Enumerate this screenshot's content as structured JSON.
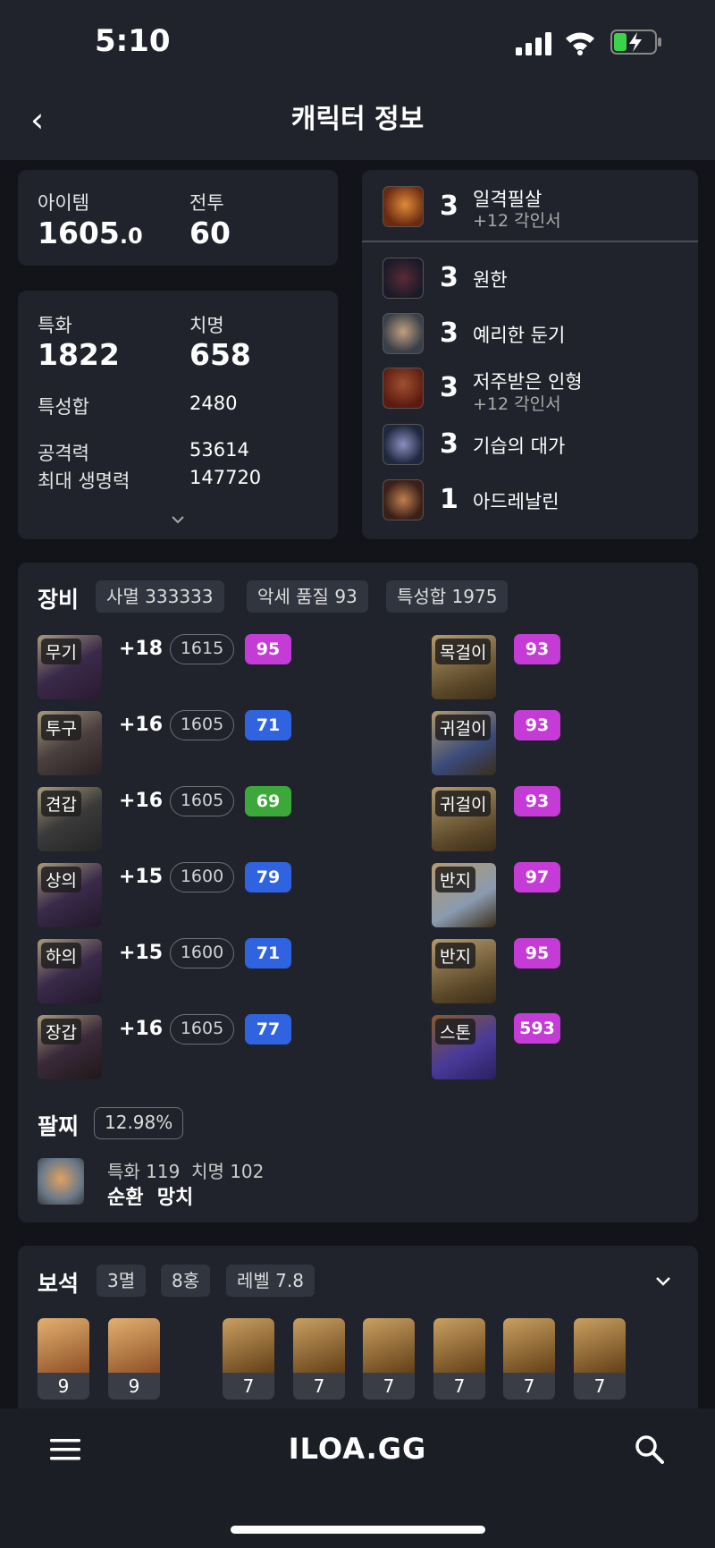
{
  "status": {
    "time": "5:10"
  },
  "header": {
    "title": "캐릭터 정보",
    "back": "‹"
  },
  "stats": {
    "item_label": "아이템",
    "item_value": "1605",
    "item_decimal": ".0",
    "battle_label": "전투",
    "battle_value": "60",
    "spec_label": "특화",
    "spec_value": "1822",
    "crit_label": "치명",
    "crit_value": "658",
    "sum_label": "특성합",
    "sum_value": "2480",
    "atk_label": "공격력",
    "atk_value": "53614",
    "hp_label": "최대 생명력",
    "hp_value": "147720"
  },
  "engravings": [
    {
      "level": "3",
      "name": "일격필살",
      "sub": "+12 각인서"
    },
    {
      "level": "3",
      "name": "원한",
      "sub": ""
    },
    {
      "level": "3",
      "name": "예리한 둔기",
      "sub": ""
    },
    {
      "level": "3",
      "name": "저주받은 인형",
      "sub": "+12 각인서"
    },
    {
      "level": "3",
      "name": "기습의 대가",
      "sub": ""
    },
    {
      "level": "1",
      "name": "아드레날린",
      "sub": ""
    }
  ],
  "equipment": {
    "title": "장비",
    "badges": [
      "사멸 333333",
      "악세 품질 93",
      "특성합 1975"
    ],
    "gear": [
      {
        "tag": "무기",
        "enh": "+18",
        "ilvl": "1615",
        "qual": "95",
        "color": "#c43bd6"
      },
      {
        "tag": "투구",
        "enh": "+16",
        "ilvl": "1605",
        "qual": "71",
        "color": "#2f63e0"
      },
      {
        "tag": "견갑",
        "enh": "+16",
        "ilvl": "1605",
        "qual": "69",
        "color": "#3da83a"
      },
      {
        "tag": "상의",
        "enh": "+15",
        "ilvl": "1600",
        "qual": "79",
        "color": "#2f63e0"
      },
      {
        "tag": "하의",
        "enh": "+15",
        "ilvl": "1600",
        "qual": "71",
        "color": "#2f63e0"
      },
      {
        "tag": "장갑",
        "enh": "+16",
        "ilvl": "1605",
        "qual": "77",
        "color": "#2f63e0"
      }
    ],
    "accessories": [
      {
        "tag": "목걸이",
        "qual": "93"
      },
      {
        "tag": "귀걸이",
        "qual": "93"
      },
      {
        "tag": "귀걸이",
        "qual": "93"
      },
      {
        "tag": "반지",
        "qual": "97"
      },
      {
        "tag": "반지",
        "qual": "95"
      },
      {
        "tag": "스톤",
        "qual": "593"
      }
    ],
    "bracelet_title": "팔찌",
    "bracelet_pct": "12.98%",
    "bracelet_stats": "특화 119  치명 102",
    "bracelet_effects": "순환  망치"
  },
  "gems": {
    "title": "보석",
    "badges": [
      "3멸",
      "8홍",
      "레벨 7.8"
    ],
    "levels": [
      "9",
      "9",
      "7",
      "7",
      "7",
      "7",
      "7",
      "7"
    ]
  },
  "nav": {
    "logo": "ILOA.GG"
  }
}
